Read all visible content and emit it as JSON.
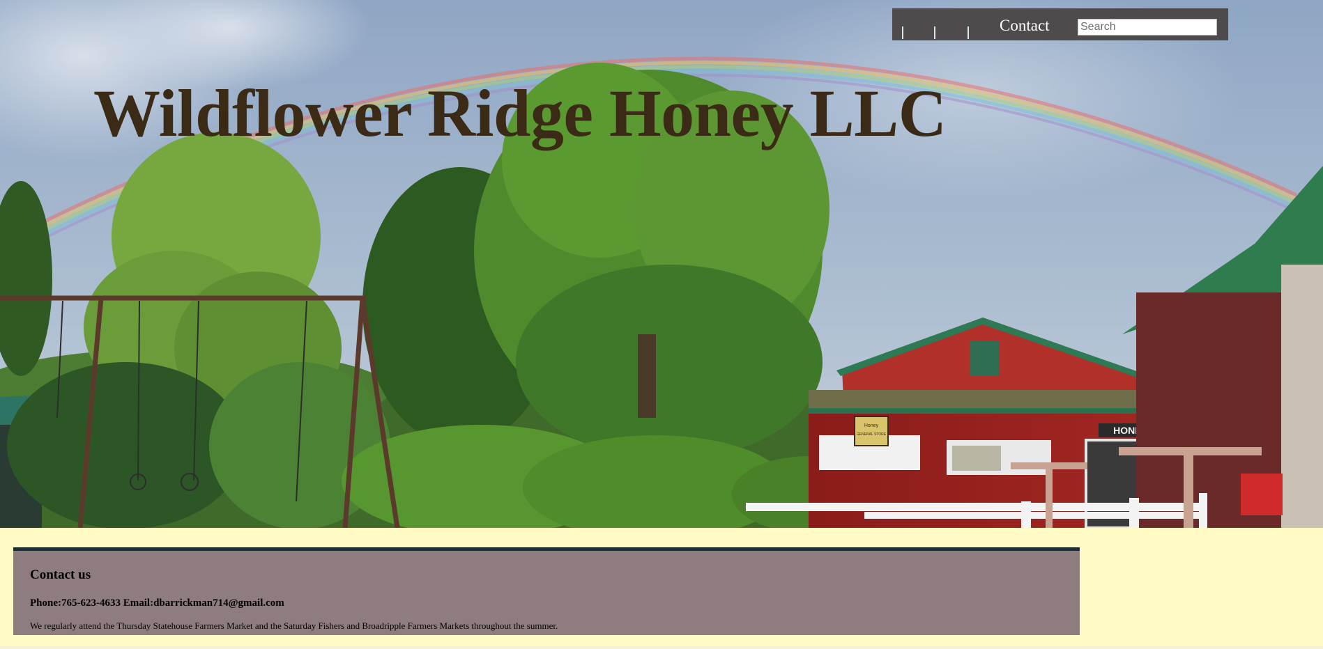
{
  "site": {
    "title": "Wildflower Ridge Honey LLC"
  },
  "nav": {
    "contact_label": "Contact",
    "search_placeholder": "Search"
  },
  "hero": {
    "barn_sign_label": "HONEY",
    "store_sign_lines": [
      "Honey",
      "GENERAL STORE"
    ]
  },
  "contact": {
    "heading": "Contact us",
    "phone_email": "Phone:765-623-4633 Email:dbarrickman714@gmail.com",
    "note": "We regularly attend the Thursday Statehouse Farmers Market and the Saturday Fishers and Broadripple Farmers Markets throughout the summer."
  },
  "colors": {
    "page_background": "#fff9c4",
    "nav_background": "#4f4b4c",
    "title_color": "#3b2b16",
    "panel_background": "#8f7c7f",
    "panel_top_border": "#1c2d33"
  }
}
